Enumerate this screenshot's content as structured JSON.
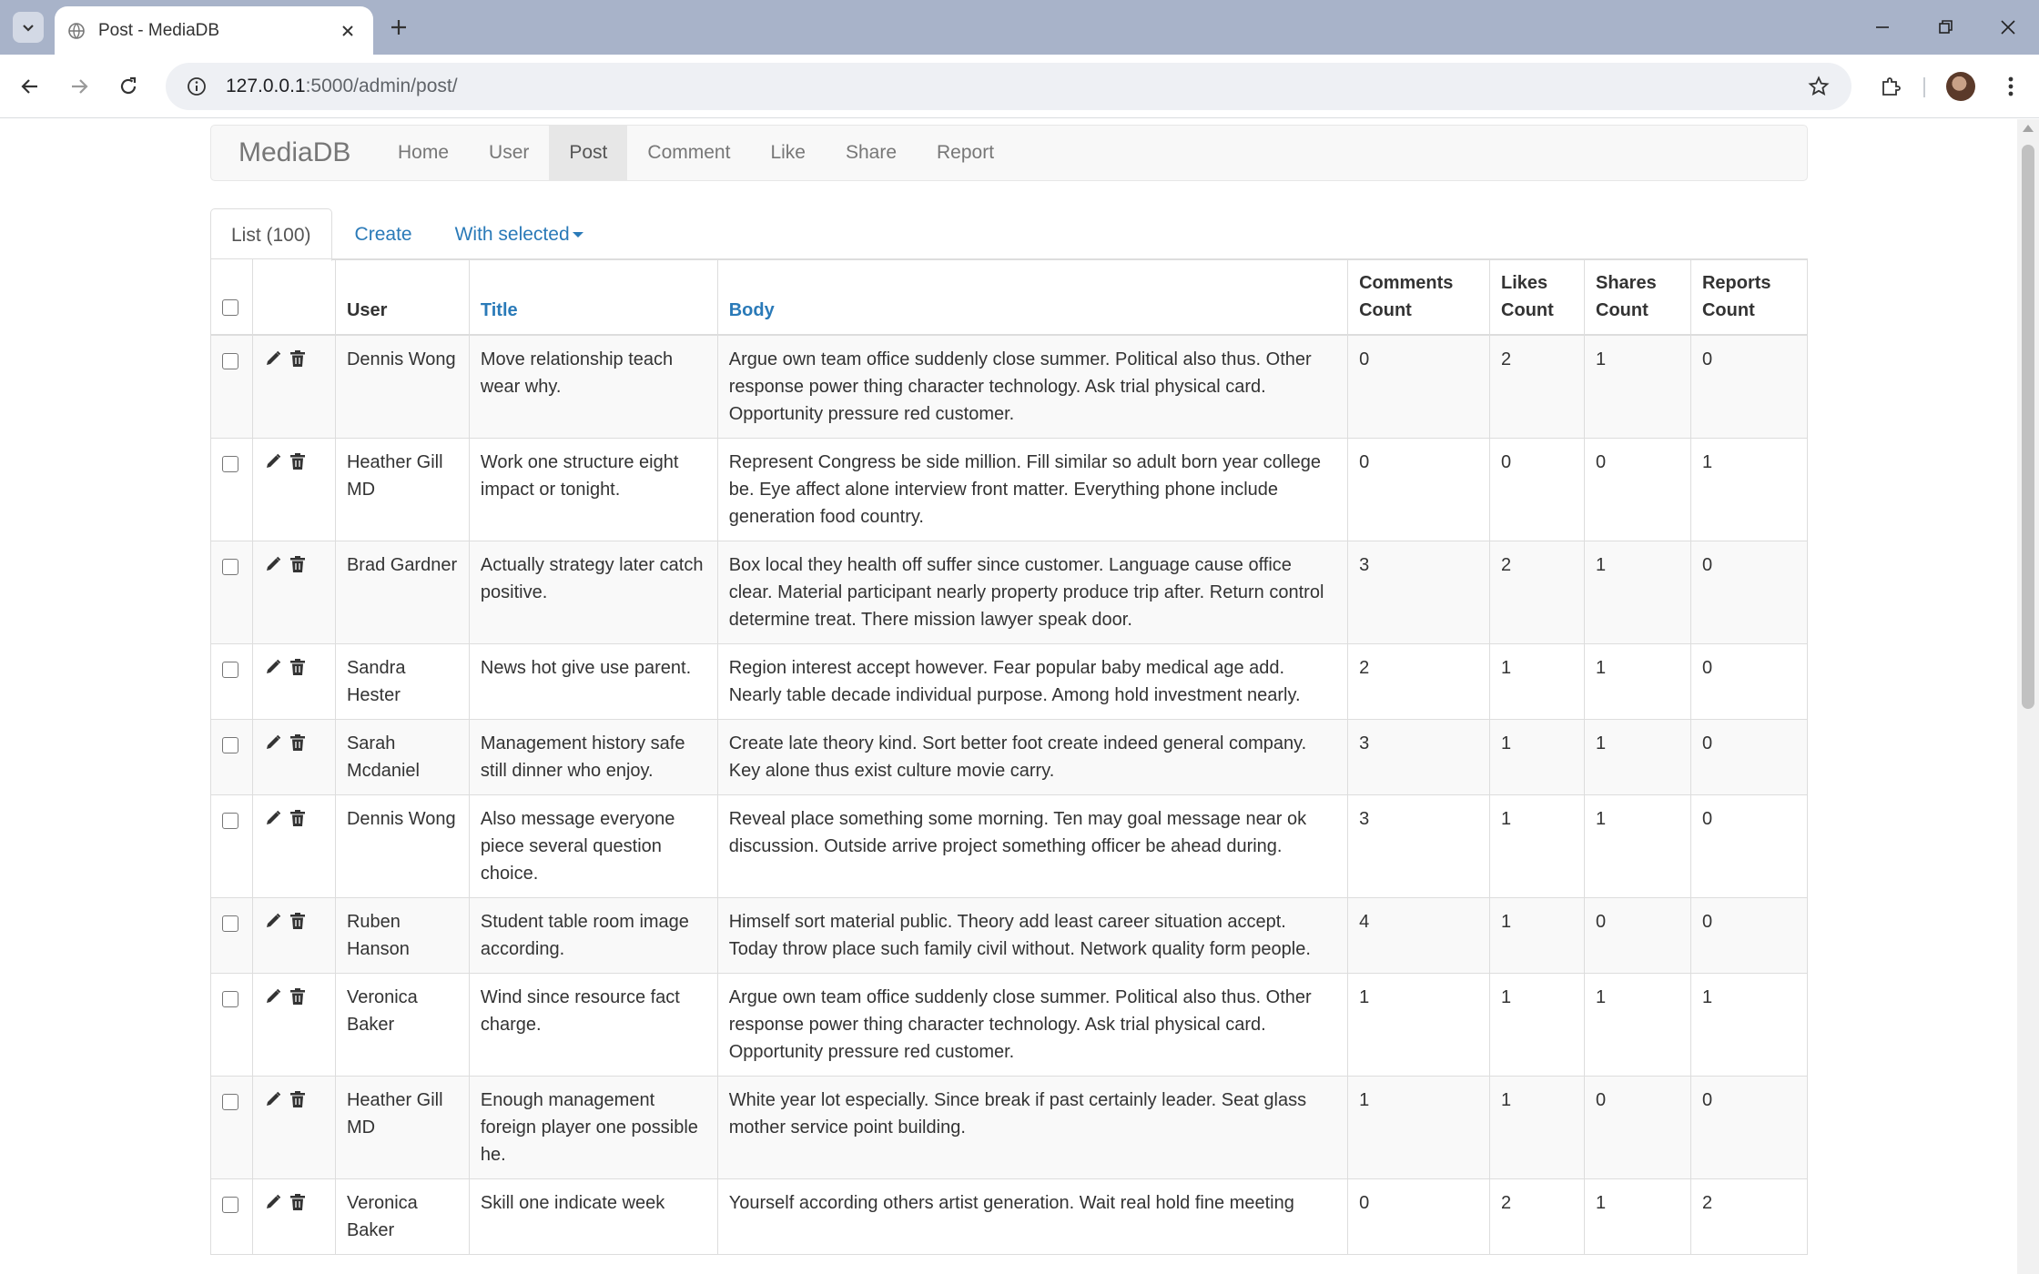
{
  "browser": {
    "tab_title": "Post - MediaDB",
    "url_host": "127.0.0.1",
    "url_rest": ":5000/admin/post/"
  },
  "navbar": {
    "brand": "MediaDB",
    "links": [
      "Home",
      "User",
      "Post",
      "Comment",
      "Like",
      "Share",
      "Report"
    ],
    "active": "Post"
  },
  "tabs": {
    "list": "List (100)",
    "create": "Create",
    "with_selected": "With selected"
  },
  "table": {
    "headers": {
      "user": "User",
      "title": "Title",
      "body": "Body",
      "comments": "Comments Count",
      "likes": "Likes Count",
      "shares": "Shares Count",
      "reports": "Reports Count"
    },
    "rows": [
      {
        "user": "Dennis Wong",
        "title": "Move relationship teach wear why.",
        "body": "Argue own team office suddenly close summer. Political also thus. Other response power thing character technology. Ask trial physical card. Opportunity pressure red customer.",
        "comments": "0",
        "likes": "2",
        "shares": "1",
        "reports": "0"
      },
      {
        "user": "Heather Gill MD",
        "title": "Work one structure eight impact or tonight.",
        "body": "Represent Congress be side million. Fill similar so adult born year college be. Eye affect alone interview front matter. Everything phone include generation food country.",
        "comments": "0",
        "likes": "0",
        "shares": "0",
        "reports": "1"
      },
      {
        "user": "Brad Gardner",
        "title": "Actually strategy later catch positive.",
        "body": "Box local they health off suffer since customer. Language cause office clear. Material participant nearly property produce trip after. Return control determine treat. There mission lawyer speak door.",
        "comments": "3",
        "likes": "2",
        "shares": "1",
        "reports": "0"
      },
      {
        "user": "Sandra Hester",
        "title": "News hot give use parent.",
        "body": "Region interest accept however. Fear popular baby medical age add. Nearly table decade individual purpose. Among hold investment nearly.",
        "comments": "2",
        "likes": "1",
        "shares": "1",
        "reports": "0"
      },
      {
        "user": "Sarah Mcdaniel",
        "title": "Management history safe still dinner who enjoy.",
        "body": "Create late theory kind. Sort better foot create indeed general company. Key alone thus exist culture movie carry.",
        "comments": "3",
        "likes": "1",
        "shares": "1",
        "reports": "0"
      },
      {
        "user": "Dennis Wong",
        "title": "Also message everyone piece several question choice.",
        "body": "Reveal place something some morning. Ten may goal message near ok discussion. Outside arrive project something officer be ahead during.",
        "comments": "3",
        "likes": "1",
        "shares": "1",
        "reports": "0"
      },
      {
        "user": "Ruben Hanson",
        "title": "Student table room image according.",
        "body": "Himself sort material public. Theory add least career situation accept. Today throw place such family civil without. Network quality form people.",
        "comments": "4",
        "likes": "1",
        "shares": "0",
        "reports": "0"
      },
      {
        "user": "Veronica Baker",
        "title": "Wind since resource fact charge.",
        "body": "Argue own team office suddenly close summer. Political also thus. Other response power thing character technology. Ask trial physical card. Opportunity pressure red customer.",
        "comments": "1",
        "likes": "1",
        "shares": "1",
        "reports": "1"
      },
      {
        "user": "Heather Gill MD",
        "title": "Enough management foreign player one possible he.",
        "body": "White year lot especially. Since break if past certainly leader. Seat glass mother service point building.",
        "comments": "1",
        "likes": "1",
        "shares": "0",
        "reports": "0"
      },
      {
        "user": "Veronica Baker",
        "title": "Skill one indicate week",
        "body": "Yourself according others artist generation. Wait real hold fine meeting",
        "comments": "0",
        "likes": "2",
        "shares": "1",
        "reports": "2"
      }
    ]
  }
}
